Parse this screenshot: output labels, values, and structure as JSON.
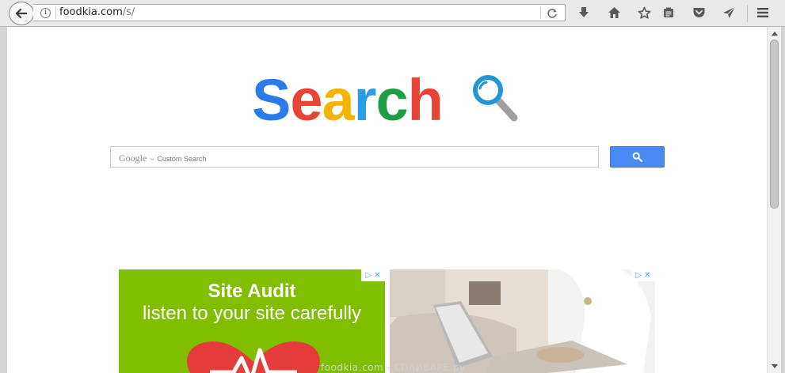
{
  "browser": {
    "url_domain": "foodkia.com",
    "url_path": "/s/",
    "toolbar_icons": [
      "back-icon",
      "info-icon",
      "reload-icon",
      "download-icon",
      "home-icon",
      "bookmark-star-icon",
      "reading-list-icon",
      "pocket-icon",
      "send-icon",
      "hamburger-menu-icon"
    ]
  },
  "page": {
    "logo": {
      "letters": [
        "S",
        "e",
        "a",
        "r",
        "c",
        "h"
      ],
      "colors": [
        "#2b7ce9",
        "#e84436",
        "#f5b400",
        "#2a9de8",
        "#1e9e44",
        "#e84436"
      ]
    },
    "search": {
      "google_label": "Google",
      "placeholder": "Custom Search",
      "button_icon": "search-icon"
    }
  },
  "ads": {
    "left": {
      "title": "Site Audit",
      "subtitle": "listen to your site carefully",
      "bg_color": "#7fbe00"
    },
    "right": {
      "description": "photo ad"
    }
  },
  "watermark": "foodkia.com - СПАЙВАРЕ.ру"
}
